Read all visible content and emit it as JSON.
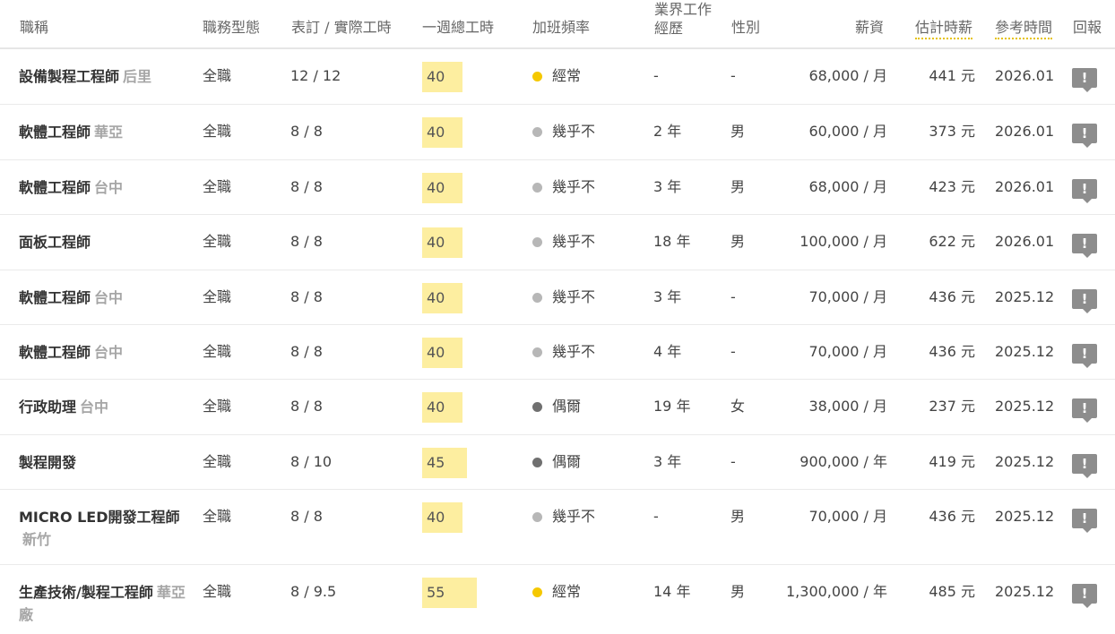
{
  "headers": {
    "title": "職稱",
    "type": "職務型態",
    "hours_fix": "表訂 / 實際工時",
    "week": "一週總工時",
    "overtime": "加班頻率",
    "exp_line1": "業界工作",
    "exp_line2": "經歷",
    "gender": "性別",
    "salary": "薪資",
    "hourly": "估計時薪",
    "ref": "參考時間",
    "report": "回報"
  },
  "colors": {
    "often": "#f5c800",
    "rarely": "#b7b7b7",
    "sometimes": "#707070",
    "hours_bg": "#fdeea0"
  },
  "report_icon": "exclamation-icon",
  "report_glyph": "!",
  "rows": [
    {
      "title": "設備製程工程師",
      "loc": "后里",
      "type": "全職",
      "fix": "12 / 12",
      "week": "40",
      "ot": "經常",
      "ot_key": "often",
      "exp": "-",
      "gender": "-",
      "salary": "68,000 / 月",
      "hourly": "441 元",
      "ref": "2026.01"
    },
    {
      "title": "軟體工程師",
      "loc": "華亞",
      "type": "全職",
      "fix": "8 / 8",
      "week": "40",
      "ot": "幾乎不",
      "ot_key": "rarely",
      "exp": "2 年",
      "gender": "男",
      "salary": "60,000 / 月",
      "hourly": "373 元",
      "ref": "2026.01"
    },
    {
      "title": "軟體工程師",
      "loc": "台中",
      "type": "全職",
      "fix": "8 / 8",
      "week": "40",
      "ot": "幾乎不",
      "ot_key": "rarely",
      "exp": "3 年",
      "gender": "男",
      "salary": "68,000 / 月",
      "hourly": "423 元",
      "ref": "2026.01"
    },
    {
      "title": "面板工程師",
      "loc": "",
      "type": "全職",
      "fix": "8 / 8",
      "week": "40",
      "ot": "幾乎不",
      "ot_key": "rarely",
      "exp": "18 年",
      "gender": "男",
      "salary": "100,000 / 月",
      "hourly": "622 元",
      "ref": "2026.01"
    },
    {
      "title": "軟體工程師",
      "loc": "台中",
      "type": "全職",
      "fix": "8 / 8",
      "week": "40",
      "ot": "幾乎不",
      "ot_key": "rarely",
      "exp": "3 年",
      "gender": "-",
      "salary": "70,000 / 月",
      "hourly": "436 元",
      "ref": "2025.12"
    },
    {
      "title": "軟體工程師",
      "loc": "台中",
      "type": "全職",
      "fix": "8 / 8",
      "week": "40",
      "ot": "幾乎不",
      "ot_key": "rarely",
      "exp": "4 年",
      "gender": "-",
      "salary": "70,000 / 月",
      "hourly": "436 元",
      "ref": "2025.12"
    },
    {
      "title": "行政助理",
      "loc": "台中",
      "type": "全職",
      "fix": "8 / 8",
      "week": "40",
      "ot": "偶爾",
      "ot_key": "sometimes",
      "exp": "19 年",
      "gender": "女",
      "salary": "38,000 / 月",
      "hourly": "237 元",
      "ref": "2025.12"
    },
    {
      "title": "製程開發",
      "loc": "",
      "type": "全職",
      "fix": "8 / 10",
      "week": "45",
      "ot": "偶爾",
      "ot_key": "sometimes",
      "exp": "3 年",
      "gender": "-",
      "salary": "900,000 / 年",
      "hourly": "419 元",
      "ref": "2025.12"
    },
    {
      "title": "MICRO LED開發工程師",
      "loc": "新竹",
      "type": "全職",
      "fix": "8 / 8",
      "week": "40",
      "ot": "幾乎不",
      "ot_key": "rarely",
      "exp": "-",
      "gender": "男",
      "salary": "70,000 / 月",
      "hourly": "436 元",
      "ref": "2025.12"
    },
    {
      "title": "生產技術/製程工程師",
      "loc": "華亞廠",
      "type": "全職",
      "fix": "8 / 9.5",
      "week": "55",
      "ot": "經常",
      "ot_key": "often",
      "exp": "14 年",
      "gender": "男",
      "salary": "1,300,000 / 年",
      "hourly": "485 元",
      "ref": "2025.12"
    }
  ]
}
